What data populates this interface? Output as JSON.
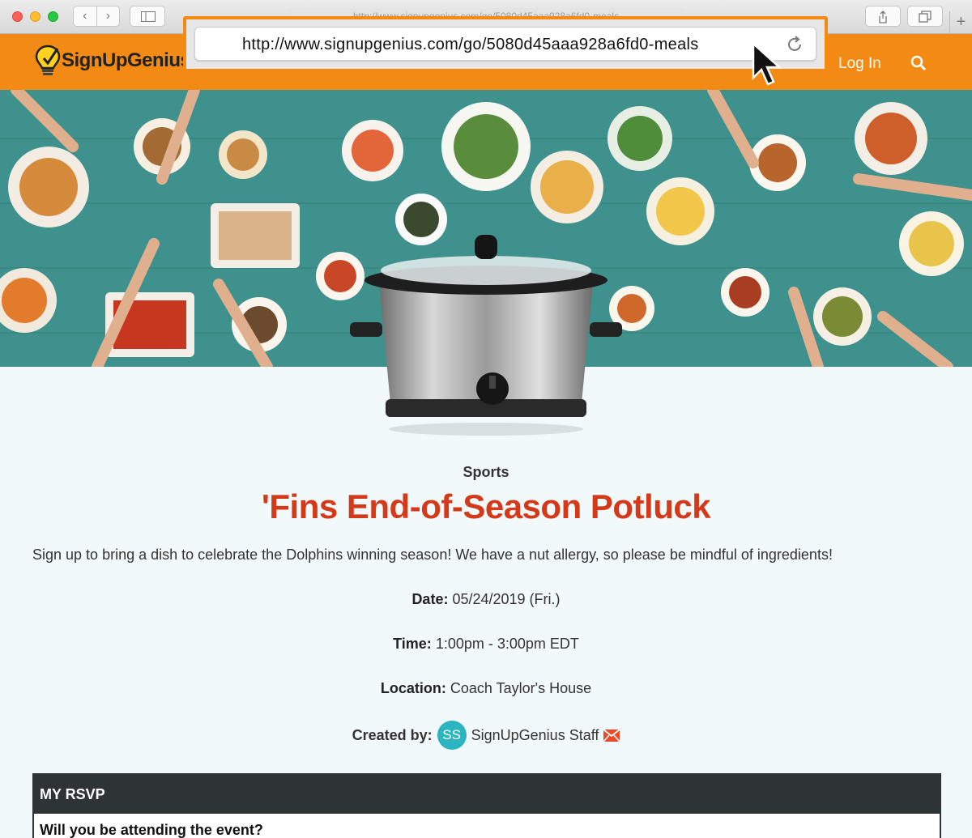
{
  "browser": {
    "small_url": "http://www.signupgenius.com/go/5080d45aaa928a6fd0-meals",
    "new_tab_label": "+",
    "back_glyph": "‹",
    "forward_glyph": "›"
  },
  "popup": {
    "url": "http://www.signupgenius.com/go/5080d45aaa928a6fd0-meals"
  },
  "header": {
    "logo_text": "SignUpGenius",
    "login_label": "Log In",
    "accent_color": "#f28a13",
    "green_color": "#8cc63f"
  },
  "event": {
    "category": "Sports",
    "title": "'Fins End-of-Season Potluck",
    "description": "Sign up to bring a dish to celebrate the Dolphins winning season! We have a nut allergy, so please be mindful of ingredients!",
    "date_label": "Date:",
    "date_value": "05/24/2019 (Fri.)",
    "time_label": "Time:",
    "time_value": "1:00pm - 3:00pm EDT",
    "location_label": "Location:",
    "location_value": "Coach Taylor's House",
    "created_label": "Created by:",
    "creator_initials": "SS",
    "creator_name": "SignUpGenius Staff",
    "title_color": "#d33a19"
  },
  "rsvp": {
    "heading": "MY RSVP",
    "question": "Will you be attending the event?"
  }
}
